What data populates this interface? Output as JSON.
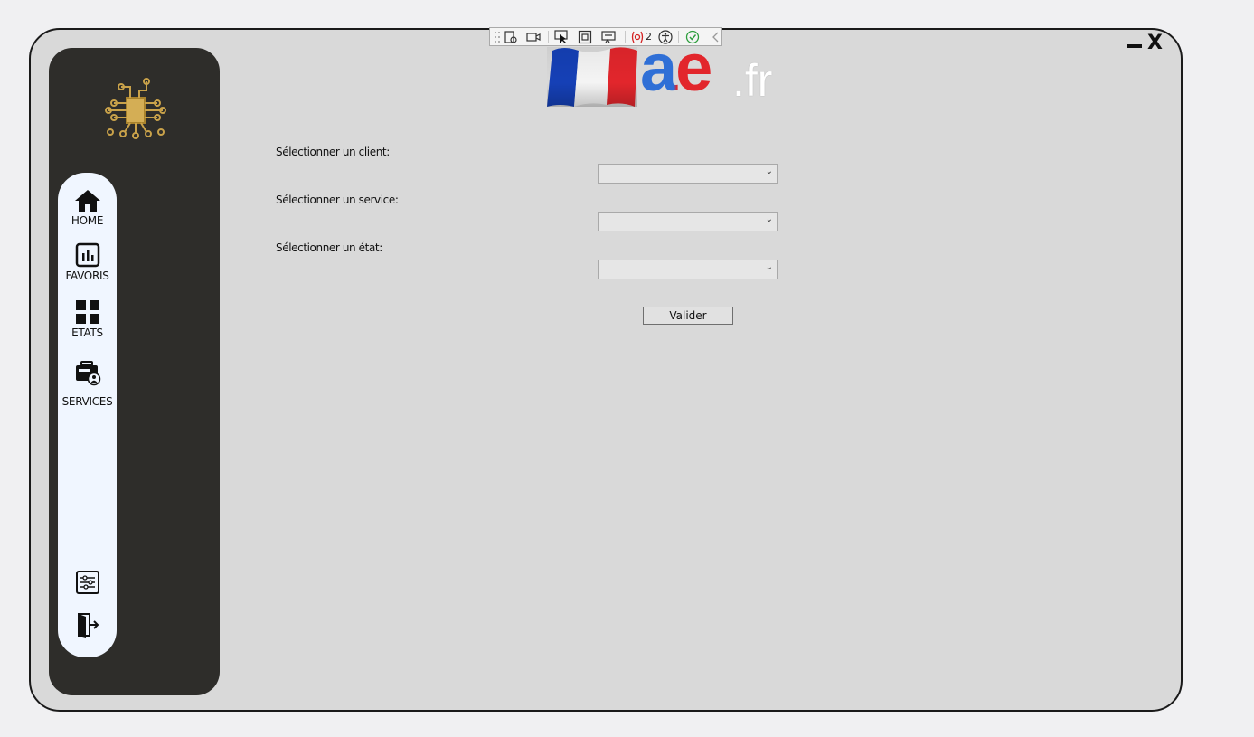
{
  "nav": {
    "items": [
      {
        "label": "HOME",
        "icon": "home-icon"
      },
      {
        "label": "FAVORIS",
        "icon": "bar-chart-icon"
      },
      {
        "label": "ETATS",
        "icon": "grid-icon"
      },
      {
        "label": "SERVICES",
        "icon": "services-icon"
      }
    ],
    "bottom": [
      {
        "icon": "settings-sliders-icon"
      },
      {
        "icon": "logout-icon"
      }
    ]
  },
  "brand": {
    "main": "ae",
    "suffix": ".fr",
    "colors": {
      "a": "#2f6fd6",
      "e": "#e2262c"
    }
  },
  "devtools": {
    "error_count": "2"
  },
  "form": {
    "client_label": "Sélectionner un client:",
    "client_value": "",
    "service_label": "Sélectionner un service:",
    "service_value": "",
    "etat_label": "Sélectionner un état:",
    "etat_value": "",
    "submit_label": "Valider"
  },
  "colors": {
    "sidebar": "#2e2d2a",
    "nav_bg": "#f0f6ff",
    "window_bg": "#d9d9d9",
    "gold": "#c9a24a"
  }
}
